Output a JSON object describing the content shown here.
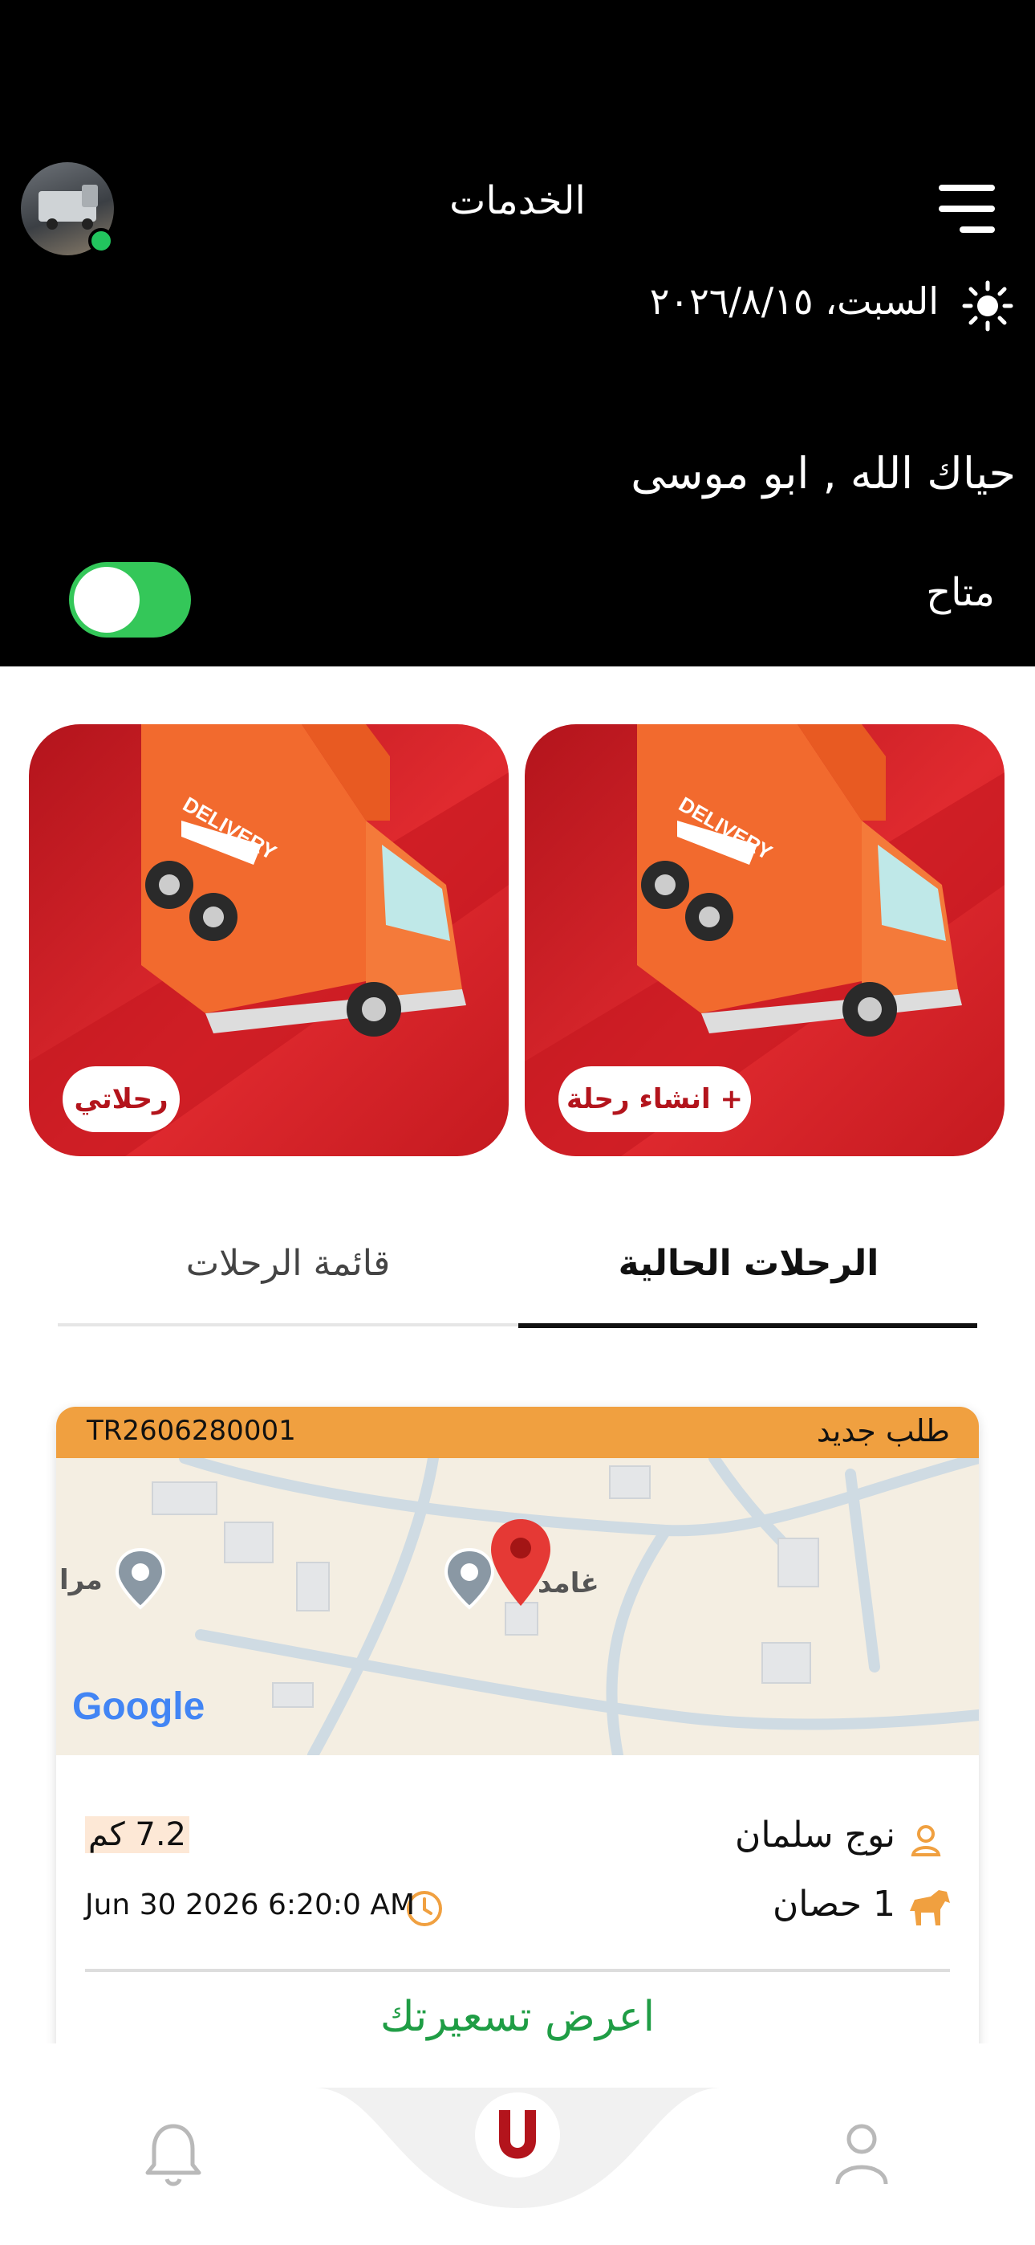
{
  "header": {
    "title": "الخدمات",
    "date": "السبت، ٢٠٢٦/٨/١٥",
    "greeting": "حياك الله , ابو موسى",
    "availability_label": "متاح",
    "availability_on": true
  },
  "actions": {
    "create_trip": "+ انشاء رحلة",
    "my_trips": "رحلاتي",
    "card_truck_text": "DELIVERY"
  },
  "tabs": {
    "current": "الرحلات الحالية",
    "list": "قائمة الرحلات"
  },
  "trip": {
    "id": "TR2606280001",
    "status": "طلب جديد",
    "map": {
      "label_left": "مرا",
      "label_right": "غامد",
      "google": "Google"
    },
    "customer": "نوج سلمان",
    "distance": "7.2 كم",
    "cargo": "1 حصان",
    "datetime": "Jun 30 2026 6:20:0 AM",
    "offer_button": "اعرض تسعيرتك"
  },
  "colors": {
    "accent": "#b3141c",
    "status_bar": "#f0a040",
    "toggle_on": "#34c759",
    "offer": "#1f9d45"
  },
  "icons": [
    "menu-icon",
    "sun-icon",
    "user-icon",
    "horse-icon",
    "clock-icon",
    "bell-icon",
    "magnet-icon",
    "profile-icon",
    "map-pin-icon"
  ]
}
